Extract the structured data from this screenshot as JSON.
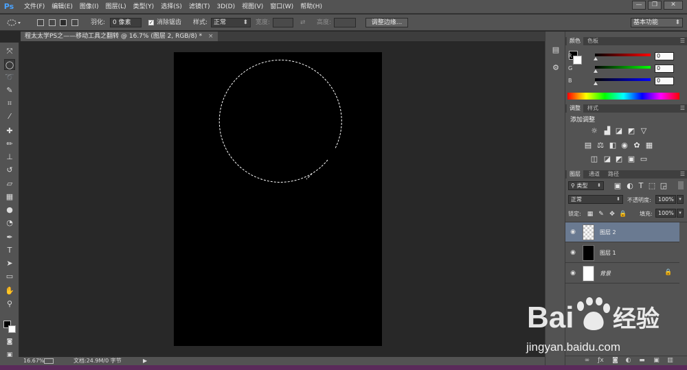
{
  "app": {
    "logo": "Ps"
  },
  "menu": [
    "文件(F)",
    "编辑(E)",
    "图像(I)",
    "图层(L)",
    "类型(Y)",
    "选择(S)",
    "滤镜(T)",
    "3D(D)",
    "视图(V)",
    "窗口(W)",
    "帮助(H)"
  ],
  "window_controls": {
    "minimize": "—",
    "restore": "❐",
    "close": "✕"
  },
  "options": {
    "feather_label": "羽化:",
    "feather_value": "0 像素",
    "antialias_label": "消除锯齿",
    "style_label": "样式:",
    "style_value": "正常",
    "width_label": "宽度:",
    "height_label": "高度:",
    "refine_edge": "调整边缘...",
    "workspace": "基本功能"
  },
  "document_tab": {
    "title": "程太太学PS之——移动工具之翻转 @ 16.7% (图层 2, RGB/8) *",
    "close": "×"
  },
  "status": {
    "zoom": "16.67%",
    "doc_info": "文档:24.9M/0 字节"
  },
  "color_panel": {
    "tabs": [
      "颜色",
      "色板"
    ],
    "channels": [
      {
        "label": "R",
        "value": "0",
        "color": "#e02020"
      },
      {
        "label": "G",
        "value": "0",
        "color": "#20c020"
      },
      {
        "label": "B",
        "value": "0",
        "color": "#2040e0"
      }
    ]
  },
  "adjustments_panel": {
    "tabs": [
      "调整",
      "样式"
    ],
    "heading": "添加调整"
  },
  "layers_panel": {
    "tabs": [
      "图层",
      "通道",
      "路径"
    ],
    "filter": "类型",
    "blend_mode": "正常",
    "opacity_label": "不透明度:",
    "opacity_value": "100%",
    "lock_label": "锁定:",
    "fill_label": "填充:",
    "fill_value": "100%",
    "layers": [
      {
        "name": "图层 2",
        "selected": true,
        "thumb": "transparent"
      },
      {
        "name": "图层 1",
        "selected": false,
        "thumb": "black"
      },
      {
        "name": "背景",
        "selected": false,
        "thumb": "white",
        "locked": true
      }
    ]
  },
  "watermark": {
    "brand": "Bai 经验",
    "url": "jingyan.baidu.com"
  },
  "colors": {
    "accent": "#4aa3ff",
    "selected_layer": "#6a7a91",
    "panel_bg": "#535353",
    "canvas_bg": "#282828"
  }
}
